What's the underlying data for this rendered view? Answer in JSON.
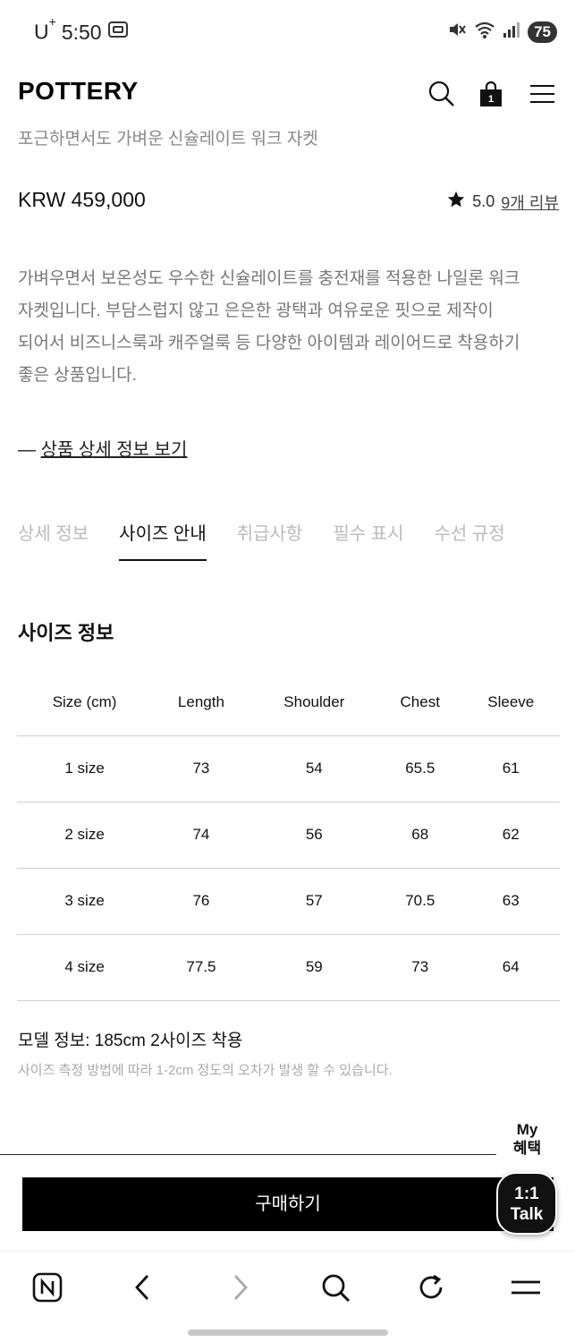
{
  "status_bar": {
    "carrier": "U",
    "carrier_sup": "+",
    "time": "5:50",
    "battery": "75"
  },
  "header": {
    "logo": "POTTERY",
    "cart_count": "1"
  },
  "product": {
    "subtitle": "포근하면서도 가벼운 신슐레이트 워크 자켓",
    "price": "KRW 459,000",
    "rating": "5.0",
    "review_link": "9개 리뷰",
    "description": [
      "가벼우면서 보온성도 우수한 신슐레이트를 충전재를 적용한 나일론 워크",
      "자켓입니다. 부담스럽지 않고 은은한 광택과 여유로운 핏으로 제작이",
      "되어서 비즈니스룩과 캐주얼룩 등 다양한 아이템과 레이어드로 착용하기",
      "좋은 상품입니다."
    ],
    "detail_link_dash": "—",
    "detail_link": "상품 상세 정보 보기"
  },
  "tabs": [
    {
      "label": "상세 정보",
      "active": false
    },
    {
      "label": "사이즈 안내",
      "active": true
    },
    {
      "label": "취급사항",
      "active": false
    },
    {
      "label": "필수 표시",
      "active": false
    },
    {
      "label": "수선 규정",
      "active": false
    }
  ],
  "size_info": {
    "title": "사이즈 정보",
    "headers": [
      "Size (cm)",
      "Length",
      "Shoulder",
      "Chest",
      "Sleeve"
    ],
    "rows": [
      [
        "1 size",
        "73",
        "54",
        "65.5",
        "61"
      ],
      [
        "2 size",
        "74",
        "56",
        "68",
        "62"
      ],
      [
        "3 size",
        "76",
        "57",
        "70.5",
        "63"
      ],
      [
        "4 size",
        "77.5",
        "59",
        "73",
        "64"
      ]
    ],
    "model_info": "모델 정보: 185cm 2사이즈 착용",
    "note": "사이즈 측정 방법에 따라 1-2cm 정도의 오차가 발생 할 수 있습니다."
  },
  "my_benefit": {
    "line1": "My",
    "line2": "혜택"
  },
  "buy_button": "구매하기",
  "talk_button": {
    "line1": "1:1",
    "line2": "Talk"
  },
  "colors": {
    "primary": "#000000",
    "muted_text": "#888888",
    "tab_inactive": "#bbbbbb",
    "divider": "#cfcfcf"
  }
}
